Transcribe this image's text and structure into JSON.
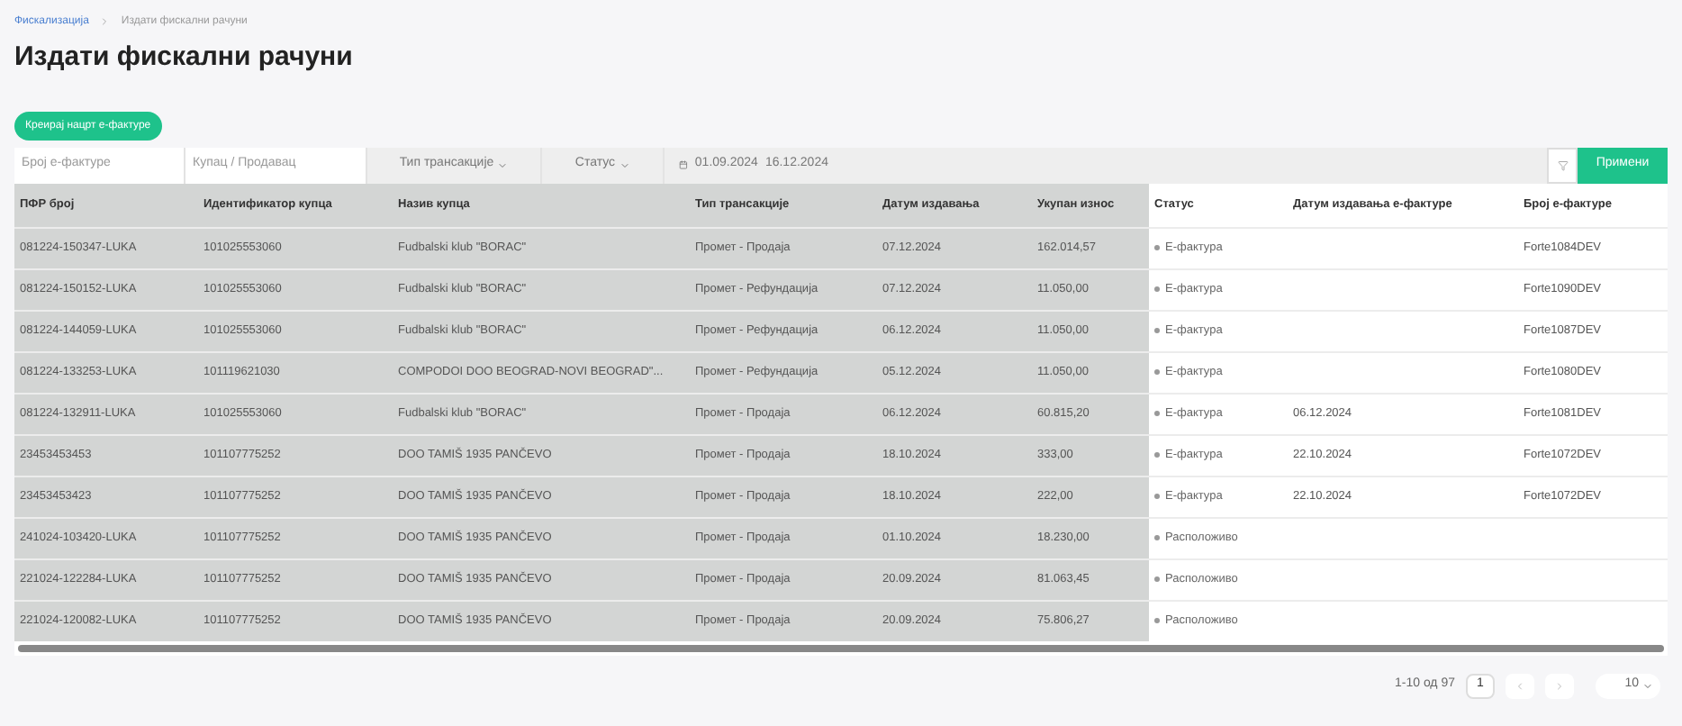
{
  "breadcrumb": [
    {
      "label": "Фискализација",
      "link": true
    },
    {
      "label": "Издати фискални рачуни",
      "link": false
    }
  ],
  "title": "Издати фискални рачуни",
  "create_button": "Креирај нацрт е-фактуре",
  "filters": {
    "invoice_number": {
      "placeholder": "Број е-фактуре"
    },
    "buyer": {
      "placeholder": "Купац / Продавац"
    },
    "transaction_type": "Тип трансакције",
    "status": "Статус",
    "date_from": "01.09.2024",
    "date_to": "16.12.2024",
    "apply_button": "Примени"
  },
  "table": {
    "columns": [
      {
        "label": "ПФР број",
        "highlighted": true,
        "kind": "text"
      },
      {
        "label": "Идентификатор купца",
        "highlighted": true,
        "kind": "text"
      },
      {
        "label": "Назив купца",
        "highlighted": true,
        "kind": "text"
      },
      {
        "label": "Тип трансакције",
        "highlighted": true,
        "kind": "text"
      },
      {
        "label": "Датум издавања",
        "highlighted": true,
        "kind": "text"
      },
      {
        "label": "Укупан износ",
        "highlighted": true,
        "kind": "text"
      },
      {
        "label": "Статус",
        "highlighted": false,
        "kind": "status"
      },
      {
        "label": "Датум издавања е-фактуре",
        "highlighted": false,
        "kind": "text"
      },
      {
        "label": "Број е-фактуре",
        "highlighted": false,
        "kind": "text"
      }
    ],
    "rows": [
      [
        "081224-150347-LUKA",
        "101025553060",
        "Fudbalski klub \"BORAC\"",
        "Промет - Продаја",
        "07.12.2024",
        "162.014,57",
        "Е-фактура",
        "",
        "Forte1084DEV"
      ],
      [
        "081224-150152-LUKA",
        "101025553060",
        "Fudbalski klub \"BORAC\"",
        "Промет - Рефундација",
        "07.12.2024",
        "11.050,00",
        "Е-фактура",
        "",
        "Forte1090DEV"
      ],
      [
        "081224-144059-LUKA",
        "101025553060",
        "Fudbalski klub \"BORAC\"",
        "Промет - Рефундација",
        "06.12.2024",
        "11.050,00",
        "Е-фактура",
        "",
        "Forte1087DEV"
      ],
      [
        "081224-133253-LUKA",
        "101119621030",
        "COMPODOI DOO BEOGRAD-NOVI BEOGRAD\"...",
        "Промет - Рефундација",
        "05.12.2024",
        "11.050,00",
        "Е-фактура",
        "",
        "Forte1080DEV"
      ],
      [
        "081224-132911-LUKA",
        "101025553060",
        "Fudbalski klub \"BORAC\"",
        "Промет - Продаја",
        "06.12.2024",
        "60.815,20",
        "Е-фактура",
        "06.12.2024",
        "Forte1081DEV"
      ],
      [
        "23453453453",
        "101107775252",
        "DOO TAMIŠ 1935 PANČEVO",
        "Промет - Продаја",
        "18.10.2024",
        "333,00",
        "Е-фактура",
        "22.10.2024",
        "Forte1072DEV"
      ],
      [
        "23453453423",
        "101107775252",
        "DOO TAMIŠ 1935 PANČEVO",
        "Промет - Продаја",
        "18.10.2024",
        "222,00",
        "Е-фактура",
        "22.10.2024",
        "Forte1072DEV"
      ],
      [
        "241024-103420-LUKA",
        "101107775252",
        "DOO TAMIŠ 1935 PANČEVO",
        "Промет - Продаја",
        "01.10.2024",
        "18.230,00",
        "Расположиво",
        "",
        ""
      ],
      [
        "221024-122284-LUKA",
        "101107775252",
        "DOO TAMIŠ 1935 PANČEVO",
        "Промет - Продаја",
        "20.09.2024",
        "81.063,45",
        "Расположиво",
        "",
        ""
      ],
      [
        "221024-120082-LUKA",
        "101107775252",
        "DOO TAMIŠ 1935 PANČEVO",
        "Промет - Продаја",
        "20.09.2024",
        "75.806,27",
        "Расположиво",
        "",
        ""
      ]
    ]
  },
  "pagination": {
    "range": "1-10 од 97",
    "pages": [
      {
        "label": "1",
        "selected": true
      }
    ],
    "page_size": "10"
  }
}
